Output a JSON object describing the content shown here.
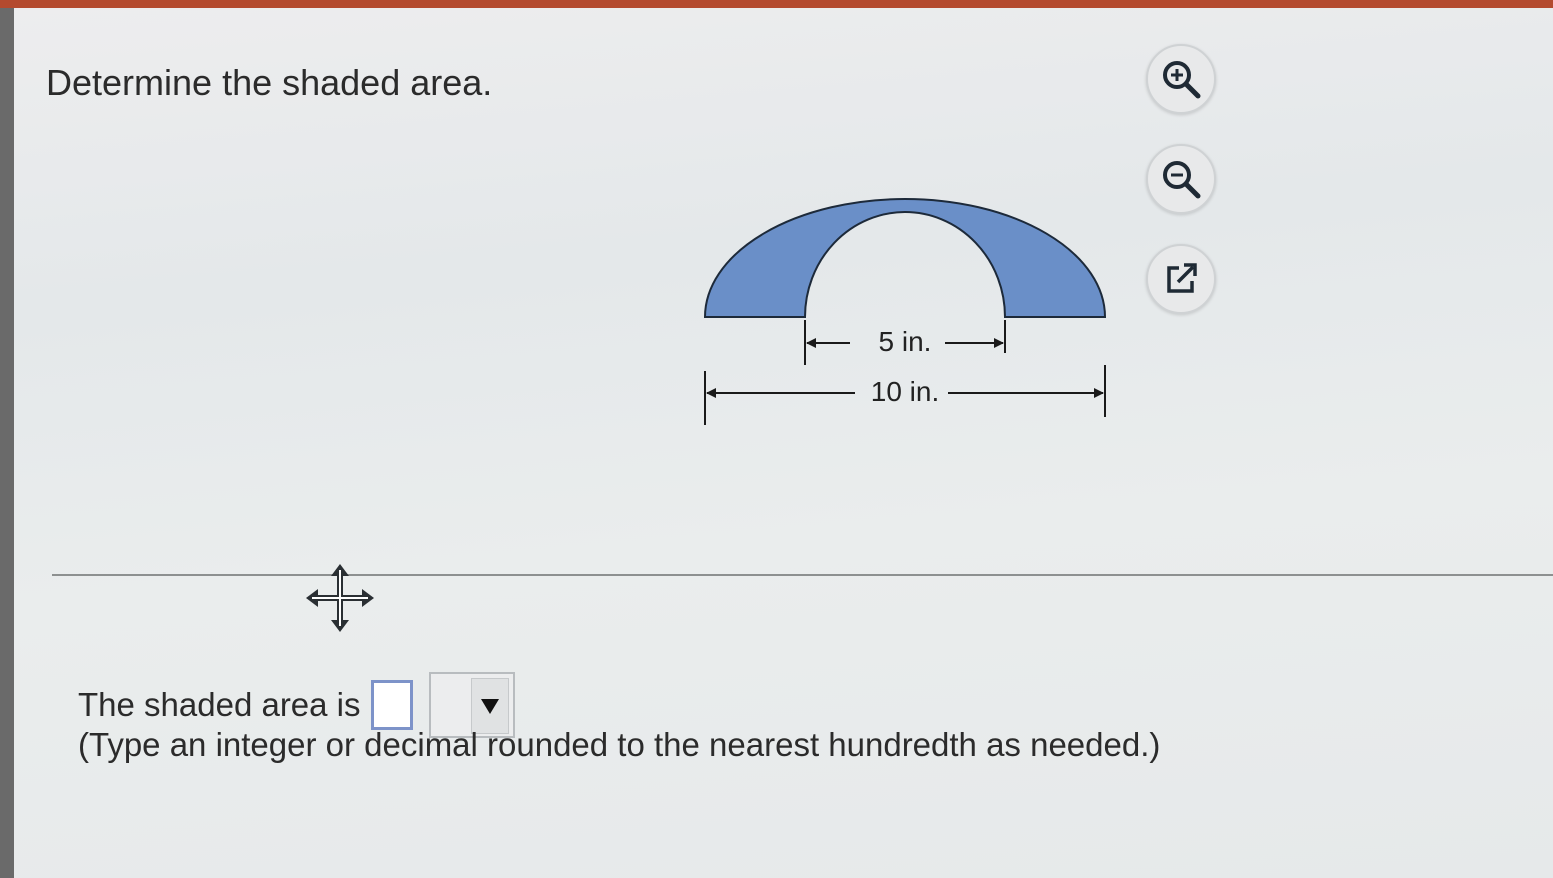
{
  "question": {
    "prompt": "Determine the shaded area."
  },
  "figure": {
    "inner_label": "5 in.",
    "outer_label": "10 in.",
    "fill_color": "#6a8fc8"
  },
  "toolbar": {
    "zoom_in_icon": "zoom-in-icon",
    "zoom_out_icon": "zoom-out-icon",
    "popout_icon": "popout-icon"
  },
  "answer": {
    "label": "The shaded area is",
    "value": "",
    "unit_selected": "",
    "hint": "(Type an integer or decimal rounded to the nearest hundredth as needed.)"
  },
  "colors": {
    "accent_bar": "#b44a2e",
    "input_border": "#7d93c9"
  }
}
